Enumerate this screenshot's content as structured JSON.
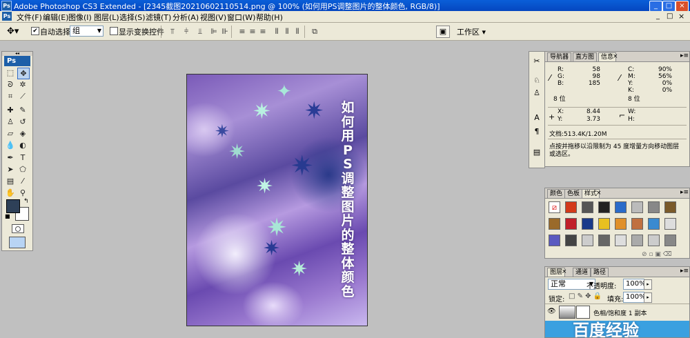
{
  "titlebar": {
    "app_icon": "Ps",
    "title": "Adobe Photoshop CS3 Extended - [2345截图20210602110514.png @ 100% (如何用PS调整图片的整体颜色, RGB/8)]",
    "min": "_",
    "max": "□",
    "close": "×"
  },
  "menubar": {
    "items": [
      "文件(F)",
      "编辑(E)",
      "图像(I)",
      "图层(L)",
      "选择(S)",
      "滤镜(T)",
      "分析(A)",
      "视图(V)",
      "窗口(W)",
      "帮助(H)"
    ],
    "min": "_",
    "max": "□",
    "close": "×"
  },
  "options": {
    "auto_select_checkbox": "✔",
    "auto_select_label": "自动选择:",
    "auto_select_value": "组",
    "show_transform_label": "显示变换控件",
    "workspace_label": "工作区"
  },
  "toolbox": {
    "ps_logo": "Ps",
    "foreground_color": "#2e4058",
    "background_color": "#ffffff"
  },
  "canvas": {
    "vertical_text": [
      "如",
      "何",
      "用",
      "P",
      "S",
      "调",
      "整",
      "图",
      "片",
      "的",
      "整",
      "体",
      "颜",
      "色"
    ]
  },
  "info_panel": {
    "tabs": [
      "导航器",
      "直方图",
      "信息"
    ],
    "active_tab": "信息",
    "rgb": [
      {
        "k": "R:",
        "v": "58"
      },
      {
        "k": "G:",
        "v": "98"
      },
      {
        "k": "B:",
        "v": "185"
      }
    ],
    "cmyk": [
      {
        "k": "C:",
        "v": "90%"
      },
      {
        "k": "M:",
        "v": "56%"
      },
      {
        "k": "Y:",
        "v": "0%"
      },
      {
        "k": "K:",
        "v": "0%"
      }
    ],
    "bits_left": "8 位",
    "bits_right": "8 位",
    "x_label": "X:",
    "x_value": "8.44",
    "y_label": "Y:",
    "y_value": "3.73",
    "w_label": "W:",
    "h_label": "H:",
    "doc_size": "文档:513.4K/1.20M",
    "hint": "点按并拖移以沿限制为 45 度增量方向移动图层或选区。"
  },
  "styles_panel": {
    "tabs": [
      "颜色",
      "色板",
      "样式"
    ],
    "active_tab": "样式",
    "swatches": [
      "#ffffff",
      "#d33a1a",
      "#555555",
      "#222222",
      "#2a6bc9",
      "#bbbbbb",
      "#888888",
      "#7a5a2a",
      "#9a6a2a",
      "#c0202a",
      "#1a3a8a",
      "#e8c020",
      "#e0902a",
      "#c07040",
      "#3a8ad0",
      "#dddddd",
      "#5a5ac0",
      "#444444",
      "#cccccc",
      "#666666",
      "#dddddd",
      "#aaaaaa",
      "#cccccc",
      "#888888"
    ]
  },
  "layers_panel": {
    "tabs": [
      "图层",
      "通道",
      "路径"
    ],
    "active_tab": "图层",
    "blend_mode": "正常",
    "opacity_label": "不透明度:",
    "opacity_value": "100%",
    "lock_label": "锁定:",
    "fill_label": "填充:",
    "fill_value": "100%",
    "layer_name": "色相/饱和度 1 副本",
    "watermark": "百度经验"
  }
}
